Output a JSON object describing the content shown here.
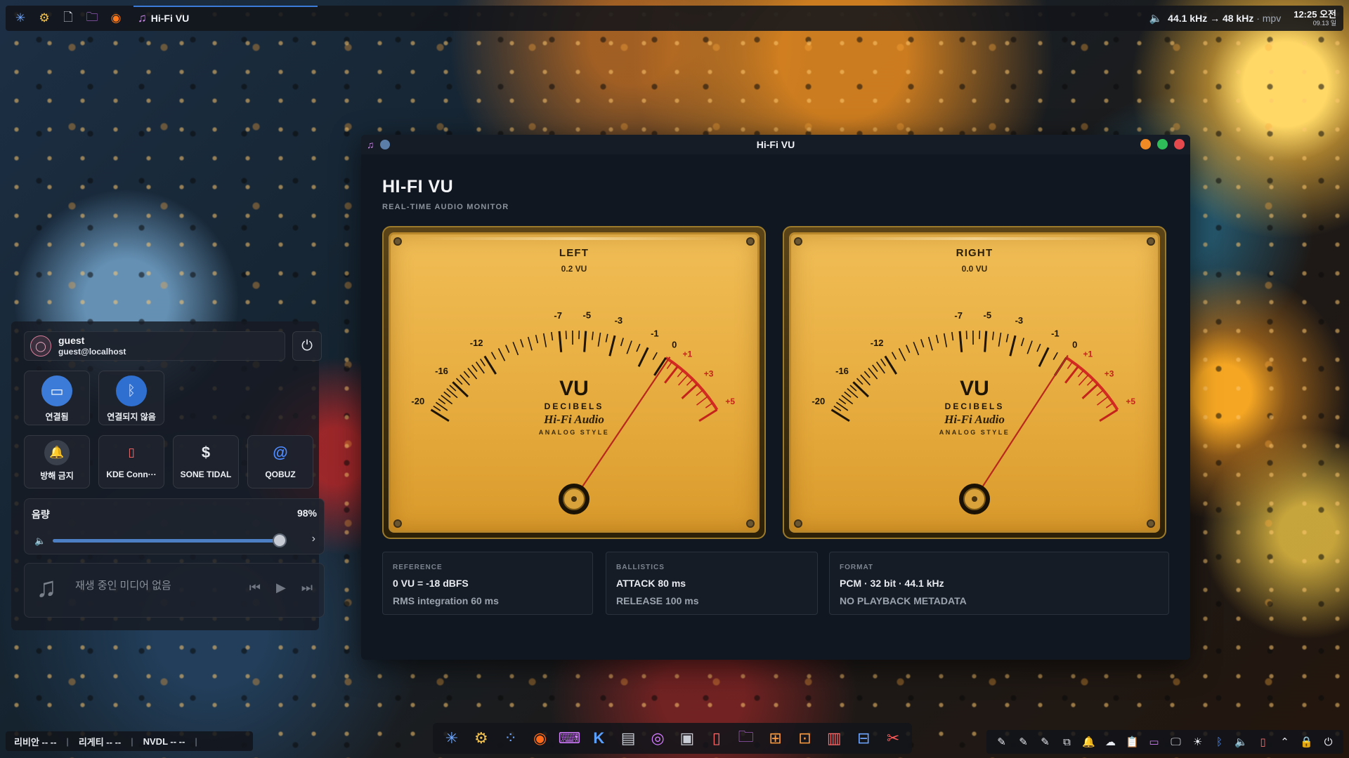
{
  "top_panel": {
    "icons": [
      "kde-logo-icon",
      "settings-icon",
      "file-icon",
      "folder-icon",
      "firefox-icon",
      "music-icon"
    ],
    "active_task": "Hi-Fi VU",
    "sample_rate": "44.1 kHz → 48 kHz",
    "player": "· mpv",
    "clock_time": "12:25 오전",
    "clock_date": "09.13 일"
  },
  "quick_settings": {
    "user_name": "guest",
    "user_host": "guest@localhost",
    "tiles_row1": [
      {
        "label": "연결됨",
        "icon": "network-icon",
        "color": "#3d7bd8"
      },
      {
        "label": "연결되지 않음",
        "icon": "bluetooth-icon",
        "color": "#2f6fd0"
      }
    ],
    "tiles_row2": [
      {
        "label": "방해 금지",
        "icon": "bell-icon"
      },
      {
        "label": "KDE Conn···",
        "icon": "phone-icon"
      },
      {
        "label": "SONE TIDAL",
        "icon": "dollar-icon"
      },
      {
        "label": "QOBUZ",
        "icon": "qobuz-icon"
      }
    ],
    "volume_label": "음량",
    "volume_percent": "98%",
    "volume_level": 0.98,
    "media_text": "재생 중인 미디어 없음"
  },
  "window": {
    "title": "Hi-Fi VU",
    "app_title": "HI-FI VU",
    "app_subtitle": "REAL-TIME AUDIO MONITOR",
    "meters": [
      {
        "name": "LEFT",
        "value_text": "0.2 VU",
        "vu": 0.2
      },
      {
        "name": "RIGHT",
        "value_text": "0.0 VU",
        "vu": 0.0
      }
    ],
    "scale_labels": [
      "-20",
      "-16",
      "-12",
      "-7",
      "-5",
      "-3",
      "-1",
      "0",
      "+1",
      "+3",
      "+5"
    ],
    "dial_text": {
      "big": "VU",
      "decibels": "DECIBELS",
      "brand": "Hi-Fi Audio",
      "style": "ANALOG STYLE"
    },
    "cards": [
      {
        "key": "REFERENCE",
        "line1": "0 VU  =  -18 dBFS",
        "line2": "RMS integration  60 ms"
      },
      {
        "key": "BALLISTICS",
        "line1": "ATTACK  80 ms",
        "line2": "RELEASE  100 ms"
      },
      {
        "key": "FORMAT",
        "line1": "PCM  ·  32 bit  ·  44.1 kHz",
        "line2": "NO PLAYBACK METADATA"
      }
    ],
    "window_buttons": {
      "minimize": "#f08a24",
      "maximize": "#2ebd59",
      "close": "#e5484d"
    }
  },
  "bottom_left": {
    "items": [
      "리비안 -- --",
      "리게티 -- --",
      "NVDL -- --"
    ]
  }
}
